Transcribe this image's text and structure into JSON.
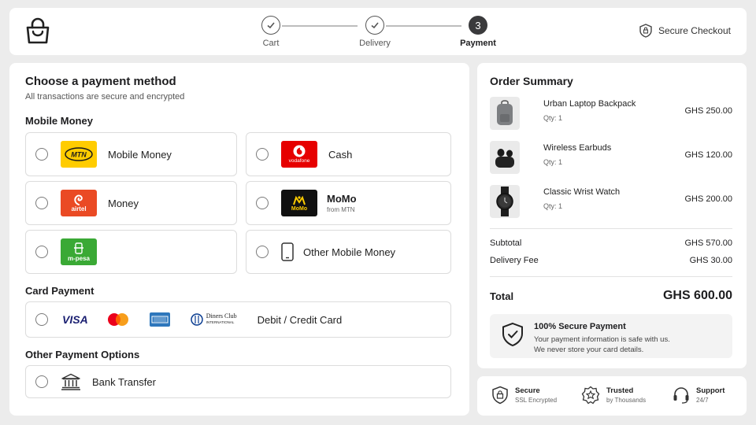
{
  "header": {
    "steps": [
      {
        "label": "Cart",
        "state": "done"
      },
      {
        "label": "Delivery",
        "state": "done"
      },
      {
        "label": "Payment",
        "state": "active",
        "number": "3"
      }
    ],
    "secure_checkout": "Secure Checkout"
  },
  "payment": {
    "title": "Choose a payment method",
    "subtitle": "All transactions are secure and encrypted",
    "mobile_money_heading": "Mobile Money",
    "options": [
      {
        "label": "Mobile Money",
        "logo_text": "MTN"
      },
      {
        "label": "Cash",
        "logo_text": "vodafone"
      },
      {
        "label": "Money",
        "logo_text": "airtel"
      },
      {
        "label": "MoMo",
        "sublabel": "from MTN",
        "logo_text": "MoMo"
      },
      {
        "label": "",
        "logo_text": "m-pesa"
      },
      {
        "label": "Other Mobile Money"
      }
    ],
    "card_heading": "Card Payment",
    "card": {
      "visa": "VISA",
      "diners_line1": "Diners Club",
      "diners_line2": "INTERNATIONAL",
      "label": "Debit / Credit Card"
    },
    "other_heading": "Other Payment Options",
    "bank_transfer": "Bank Transfer"
  },
  "summary": {
    "title": "Order Summary",
    "items": [
      {
        "name": "Urban Laptop Backpack",
        "qty": "Qty: 1",
        "price": "GHS 250.00"
      },
      {
        "name": "Wireless Earbuds",
        "qty": "Qty: 1",
        "price": "GHS 120.00"
      },
      {
        "name": "Classic Wrist Watch",
        "qty": "Qty: 1",
        "price": "GHS 200.00"
      }
    ],
    "subtotal_label": "Subtotal",
    "subtotal_value": "GHS 570.00",
    "delivery_label": "Delivery Fee",
    "delivery_value": "GHS 30.00",
    "total_label": "Total",
    "total_value": "GHS 600.00",
    "secure_title": "100% Secure Payment",
    "secure_line1": "Your payment information is safe with us.",
    "secure_line2": "We never store your card details."
  },
  "trust": [
    {
      "title": "Secure",
      "sub": "SSL Encrypted",
      "icon": "shield-lock-icon"
    },
    {
      "title": "Trusted",
      "sub": "by Thousands",
      "icon": "badge-star-icon"
    },
    {
      "title": "Support",
      "sub": "24/7",
      "icon": "headset-icon"
    }
  ],
  "colors": {
    "mtn": "#ffcc00",
    "vodafone": "#e60000",
    "airtel": "#ea4a24",
    "momo": "#111111",
    "mpesa": "#3aa935",
    "mastercard_red": "#eb001b",
    "mastercard_yellow": "#f79e1b",
    "amex": "#2e77bc",
    "visa": "#1a1f71"
  }
}
